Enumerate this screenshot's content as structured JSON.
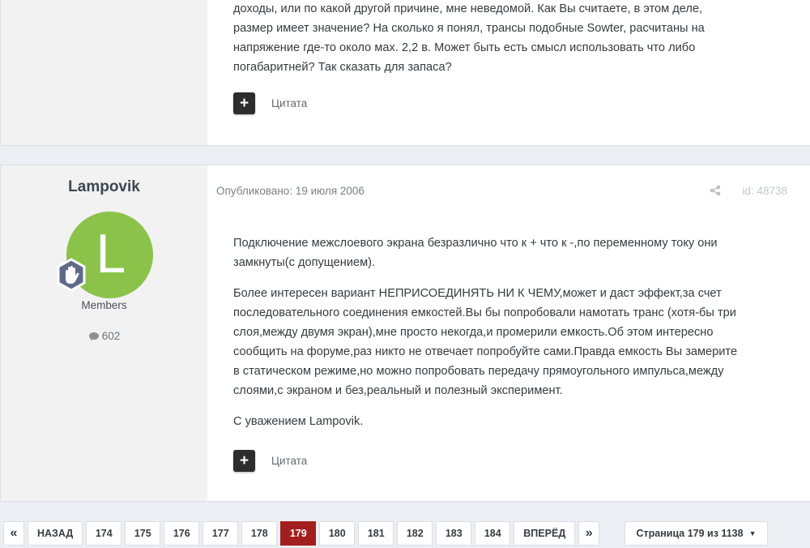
{
  "top_post": {
    "lines": [
      "доходы, или по какой другой причине, мне неведомой. Как Вы считаете, в этом деле,",
      "размер имеет значение? На сколько я понял, трансы подобные Sowter, расчитаны на",
      "напряжение где-то около мах. 2,2 в. Может быть есть смысл использовать что либо",
      "погабаритней? Так сказать для запаса?"
    ],
    "quote_label": "Цитата",
    "plus_glyph": "+"
  },
  "post": {
    "author": "Lampovik",
    "avatar_letter": "L",
    "avatar_color": "#8bc34a",
    "rank_icon": "hand-badge-icon",
    "group": "Members",
    "post_count": "602",
    "published": "Опубликовано: 19 июля 2006",
    "post_id": "id: 48738",
    "paragraphs": [
      [
        "Подключение межслоевого экрана безразлично что к + что к -,по переменному току они",
        "замкнуты(с допущением)."
      ],
      [
        "Более интересен вариант НЕПРИСОЕДИНЯТЬ НИ К ЧЕМУ,может и даст эффект,за счет",
        "последовательного соединения емкостей.Вы бы попробовали намотать транс (хотя-бы три",
        "слоя,между двумя экран),мне просто некогда,и промерили емкость.Об этом интересно",
        "сообщить на форуме,раз никто не отвечает попробуйте сами.Правда емкость Вы замерите",
        "в статическом режиме,но можно попробовать передачу прямоугольного импульса,между",
        "слоями,с экраном и без,реальный и полезный эксперимент."
      ],
      [
        "С уважением Lampovik."
      ]
    ],
    "quote_label": "Цитата",
    "plus_glyph": "+"
  },
  "pagination": {
    "first": "«",
    "prev": "НАЗАД",
    "pages": [
      "174",
      "175",
      "176",
      "177",
      "178",
      "179",
      "180",
      "181",
      "182",
      "183",
      "184"
    ],
    "current": "179",
    "next": "ВПЕРЁД",
    "last": "»",
    "page_status": "Страница 179 из 1138",
    "caret": "▼"
  },
  "colors": {
    "accent": "#a31f1f",
    "background": "#ebeef2"
  }
}
